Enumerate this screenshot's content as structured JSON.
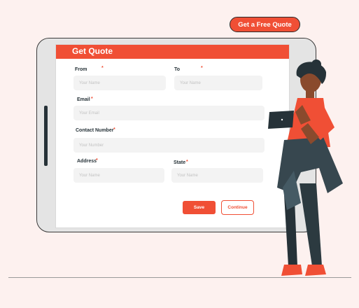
{
  "cta": {
    "label": "Get a Free Quote"
  },
  "form": {
    "title": "Get Quote",
    "from": {
      "label": "From",
      "required": "*",
      "placeholder": "Your Name"
    },
    "to": {
      "label": "To",
      "required": "*",
      "placeholder": "Your Name"
    },
    "email": {
      "label": "Email",
      "required": "*",
      "placeholder": "Your Email"
    },
    "contact": {
      "label": "Contact Number",
      "required": "*",
      "placeholder": "Your Number"
    },
    "address": {
      "label": "Address",
      "required": "*",
      "placeholder": "Your Name"
    },
    "state": {
      "label": "State",
      "required": "*",
      "placeholder": "Your Name"
    },
    "save_label": "Save",
    "continue_label": "Continue"
  },
  "colors": {
    "accent": "#f04f35",
    "background": "#fdf1ef",
    "dark": "#263238"
  },
  "illustration": {
    "icon": "person-with-tablet-icon"
  }
}
